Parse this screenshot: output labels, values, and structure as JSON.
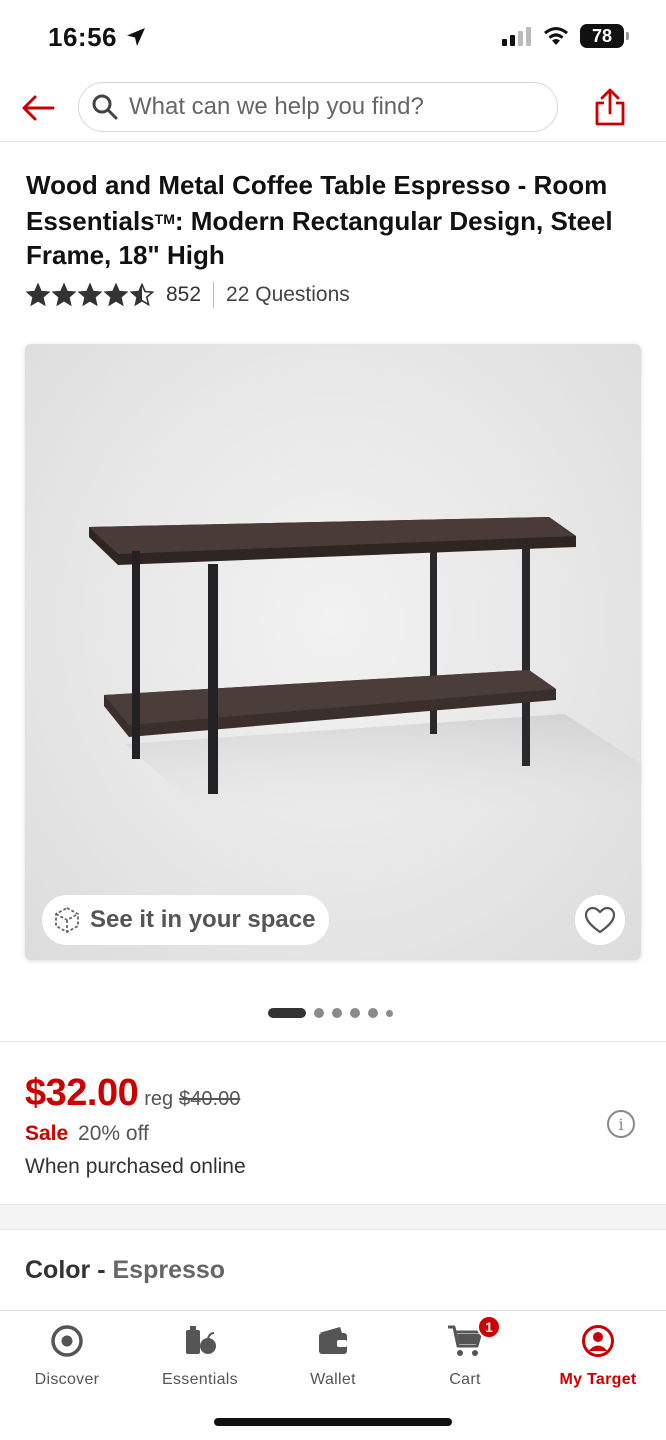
{
  "status": {
    "time": "16:56",
    "battery": "78"
  },
  "search": {
    "placeholder": "What can we help you find?"
  },
  "product": {
    "title": "Wood and Metal Coffee Table Espresso - Room Essentials",
    "title_tm": "TM",
    "title_rest": ": Modern Rectangular Design, Steel Frame, 18\" High",
    "rating": 4.5,
    "rating_count": "852",
    "questions": "22 Questions",
    "ar_label": "See it in your space",
    "image_count": 6,
    "image_index": 0
  },
  "pricing": {
    "price": "$32.00",
    "reg_label": "reg",
    "reg_price": "$40.00",
    "sale_label": "Sale",
    "sale_off": "20% off",
    "note": "When purchased online"
  },
  "variant": {
    "label": "Color",
    "separator": " - ",
    "value": "Espresso"
  },
  "tabs": [
    {
      "label": "Discover",
      "icon": "target-icon"
    },
    {
      "label": "Essentials",
      "icon": "grocery-icon"
    },
    {
      "label": "Wallet",
      "icon": "wallet-icon"
    },
    {
      "label": "Cart",
      "icon": "cart-icon",
      "badge": "1"
    },
    {
      "label": "My Target",
      "icon": "account-icon",
      "active": true
    }
  ],
  "colors": {
    "accent": "#cc0000",
    "text": "#222222",
    "muted": "#555555"
  }
}
